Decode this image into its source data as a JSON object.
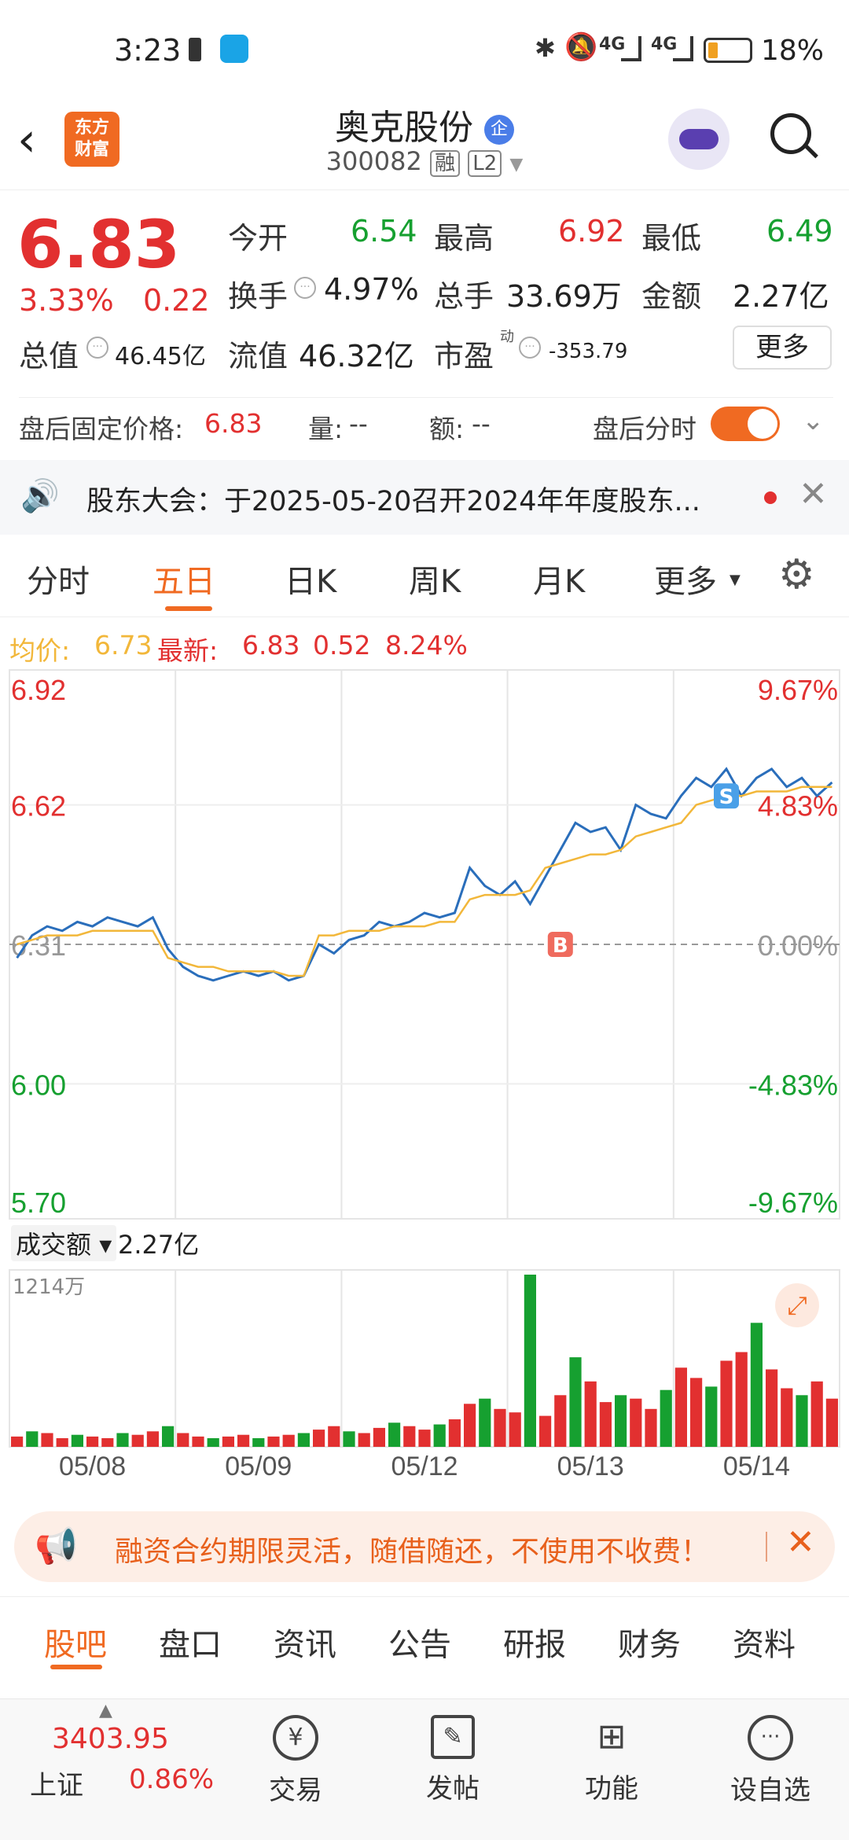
{
  "status_bar": {
    "time": "3:23",
    "battery": "18%",
    "network": "4G"
  },
  "header": {
    "logo_text": "东方\n财富",
    "stock_name": "奥克股份",
    "name_badge": "企",
    "code": "300082",
    "tag_margin": "融",
    "tag_level": "L2"
  },
  "quote": {
    "price": "6.83",
    "change_pct": "3.33%",
    "change": "0.22",
    "open_label": "今开",
    "open": "6.54",
    "high_label": "最高",
    "high": "6.92",
    "low_label": "最低",
    "low": "6.49",
    "turnover_label": "换手",
    "turnover": "4.97%",
    "volume_label": "总手",
    "volume": "33.69万",
    "amount_label": "金额",
    "amount": "2.27亿",
    "mktcap_label": "总值",
    "mktcap": "46.45亿",
    "float_label": "流值",
    "float_cap": "46.32亿",
    "pe_label": "市盈",
    "pe_sup": "动",
    "pe": "-353.79",
    "more": "更多"
  },
  "afterhours": {
    "price_label": "盘后固定价格:",
    "price": "6.83",
    "vol_label": "量:",
    "vol": "--",
    "amt_label": "额:",
    "amt": "--",
    "toggle_label": "盘后分时"
  },
  "notice": {
    "text": "股东大会：于2025-05-20召开2024年年度股东..."
  },
  "tabs": [
    "分时",
    "五日",
    "日K",
    "周K",
    "月K",
    "更多"
  ],
  "active_tab": 1,
  "legend": {
    "avg_label": "均价:",
    "avg": "6.73",
    "latest_label": "最新:",
    "latest": "6.83",
    "latest_chg": "0.52",
    "latest_pct": "8.24%"
  },
  "chart_data": {
    "type": "line",
    "y_left_ticks": [
      "6.92",
      "6.62",
      "6.31",
      "6.00",
      "5.70"
    ],
    "y_right_ticks": [
      "9.67%",
      "4.83%",
      "0.00%",
      "-4.83%",
      "-9.67%"
    ],
    "ylim": [
      5.7,
      6.92
    ],
    "prev_close": 6.31,
    "days": [
      "05/08",
      "05/09",
      "05/12",
      "05/13",
      "05/14"
    ],
    "series": [
      {
        "name": "最新",
        "color": "#2a6ebb",
        "values": [
          6.28,
          6.33,
          6.35,
          6.34,
          6.36,
          6.35,
          6.37,
          6.36,
          6.35,
          6.37,
          6.3,
          6.26,
          6.24,
          6.23,
          6.24,
          6.25,
          6.24,
          6.25,
          6.23,
          6.24,
          6.31,
          6.29,
          6.32,
          6.33,
          6.36,
          6.35,
          6.36,
          6.38,
          6.37,
          6.38,
          6.48,
          6.44,
          6.42,
          6.45,
          6.4,
          6.46,
          6.52,
          6.58,
          6.56,
          6.57,
          6.52,
          6.62,
          6.6,
          6.59,
          6.64,
          6.68,
          6.66,
          6.7,
          6.64,
          6.68,
          6.7,
          6.66,
          6.68,
          6.64,
          6.67
        ]
      },
      {
        "name": "均价",
        "color": "#f2b73a",
        "values": [
          6.31,
          6.32,
          6.33,
          6.33,
          6.33,
          6.34,
          6.34,
          6.34,
          6.34,
          6.34,
          6.28,
          6.27,
          6.26,
          6.26,
          6.25,
          6.25,
          6.25,
          6.25,
          6.24,
          6.24,
          6.33,
          6.33,
          6.34,
          6.34,
          6.34,
          6.35,
          6.35,
          6.35,
          6.36,
          6.36,
          6.41,
          6.42,
          6.42,
          6.42,
          6.43,
          6.48,
          6.49,
          6.5,
          6.51,
          6.51,
          6.52,
          6.55,
          6.56,
          6.57,
          6.58,
          6.62,
          6.63,
          6.64,
          6.64,
          6.65,
          6.65,
          6.65,
          6.66,
          6.66,
          6.66
        ]
      }
    ],
    "markers": [
      {
        "label": "B",
        "day_index": 3,
        "value": 6.31,
        "color": "#ef6b5e"
      },
      {
        "label": "S",
        "day_index": 4,
        "value": 6.64,
        "color": "#4aa0e8"
      }
    ],
    "volume": {
      "label": "成交额",
      "total": "2.27亿",
      "max_label": "1214万",
      "values": [
        0.06,
        0.09,
        0.08,
        0.05,
        0.07,
        0.06,
        0.05,
        0.08,
        0.07,
        0.09,
        0.12,
        0.08,
        0.06,
        0.05,
        0.06,
        0.07,
        0.05,
        0.06,
        0.07,
        0.08,
        0.1,
        0.12,
        0.09,
        0.08,
        0.11,
        0.14,
        0.12,
        0.1,
        0.13,
        0.16,
        0.25,
        0.28,
        0.22,
        0.2,
        1.0,
        0.18,
        0.3,
        0.52,
        0.38,
        0.26,
        0.3,
        0.28,
        0.22,
        0.33,
        0.46,
        0.4,
        0.35,
        0.5,
        0.55,
        0.72,
        0.45,
        0.34,
        0.3,
        0.38,
        0.28
      ]
    }
  },
  "promo": {
    "text": "融资合约期限灵活，随借随还，不使用不收费！"
  },
  "bottom_tabs": [
    "股吧",
    "盘口",
    "资讯",
    "公告",
    "研报",
    "财务",
    "资料"
  ],
  "footer": {
    "index_value": "3403.95",
    "index_name": "上证",
    "index_pct": "0.86%",
    "items": [
      "交易",
      "发帖",
      "功能",
      "设自选"
    ]
  }
}
